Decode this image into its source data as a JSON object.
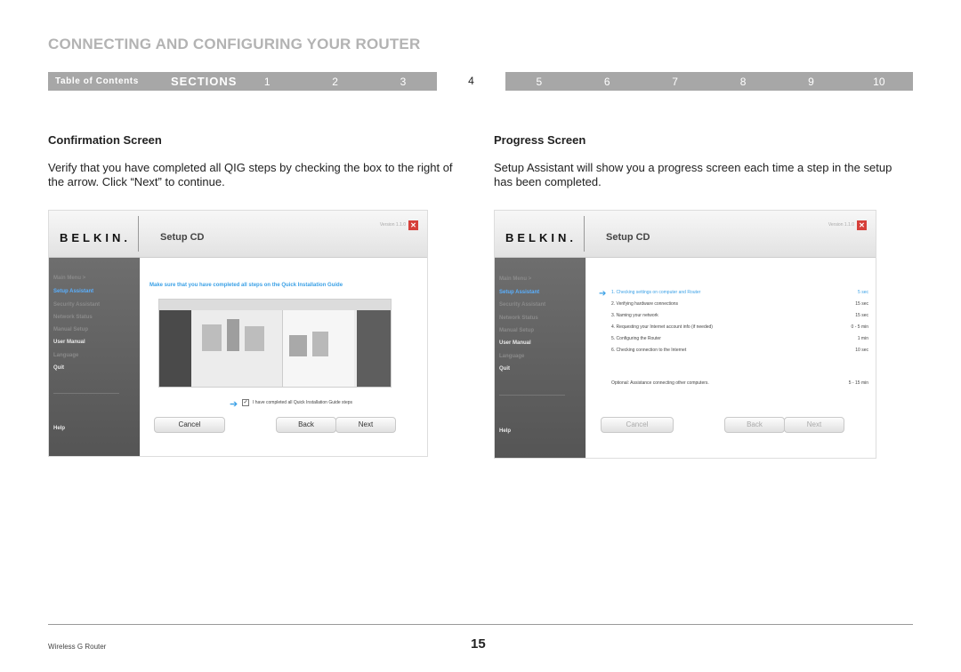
{
  "page": {
    "title": "CONNECTING AND CONFIGURING YOUR ROUTER",
    "footer_left": "Wireless G Router",
    "page_number": "15"
  },
  "nav": {
    "toc_label": "Table of Contents",
    "sections_label": "SECTIONS",
    "numbers": [
      "1",
      "2",
      "3",
      "4",
      "5",
      "6",
      "7",
      "8",
      "9",
      "10"
    ],
    "active": "4"
  },
  "left": {
    "heading": "Confirmation Screen",
    "body": "Verify that you have completed all QIG steps by checking the box to the right of the arrow. Click “Next” to continue."
  },
  "right": {
    "heading": "Progress Screen",
    "body": "Setup Assistant will show you a progress screen each time a step in the setup has been completed."
  },
  "app": {
    "logo": "BELKIN.",
    "title": "Setup CD",
    "version": "Version 1.1.0",
    "menu": [
      "Main Menu  >",
      "Setup Assistant",
      "Security Assistant",
      "Network Status",
      "Manual Setup",
      "User Manual",
      "Language",
      "Quit"
    ],
    "help": "Help",
    "buttons": {
      "cancel": "Cancel",
      "back": "Back",
      "next": "Next"
    }
  },
  "confirm": {
    "instruction": "Make sure that you have completed all steps on the Quick Installation Guide",
    "checkbox_label": "I have completed all Quick Installation Guide steps"
  },
  "progress": {
    "steps": [
      {
        "text": "1. Checking settings on computer and Router",
        "time": "5 sec"
      },
      {
        "text": "2. Verifying hardware connections",
        "time": "15 sec"
      },
      {
        "text": "3. Naming your network",
        "time": "15 sec"
      },
      {
        "text": "4. Requesting your Internet account info (if needed)",
        "time": "0 - 5 min"
      },
      {
        "text": "5. Configuring the Router",
        "time": "1 min"
      },
      {
        "text": "6. Checking connection to the Internet",
        "time": "10 sec"
      }
    ],
    "optional": {
      "text": "Optional: Assistance connecting other computers.",
      "time": "5 - 15 min"
    }
  },
  "colors": {
    "accent_blue": "#3aa0e6",
    "close_red": "#d6403a",
    "nav_gray": "#a7a7a7"
  }
}
